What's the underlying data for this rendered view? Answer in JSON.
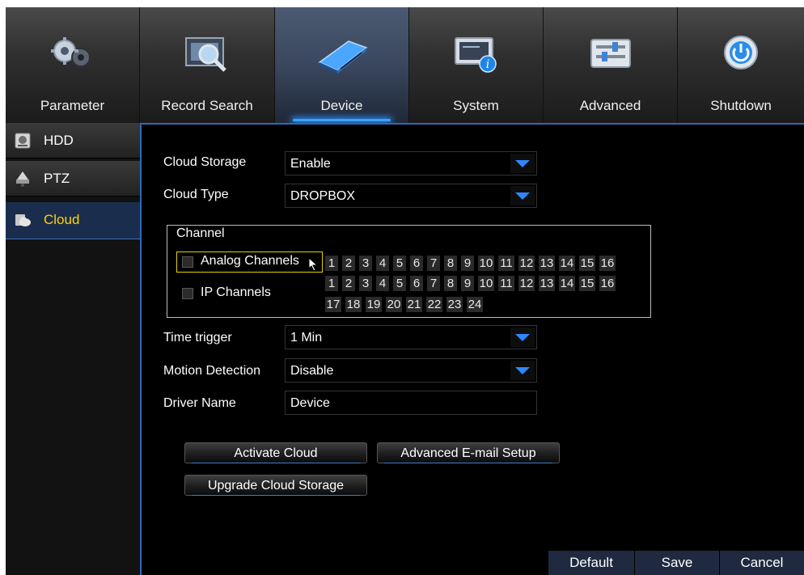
{
  "tabs": [
    {
      "label": "Parameter",
      "icon": "gears-icon"
    },
    {
      "label": "Record Search",
      "icon": "magnifier-film-icon"
    },
    {
      "label": "Device",
      "icon": "hard-drive-icon",
      "active": true
    },
    {
      "label": "System",
      "icon": "monitor-info-icon"
    },
    {
      "label": "Advanced",
      "icon": "sliders-panel-icon"
    },
    {
      "label": "Shutdown",
      "icon": "power-icon"
    }
  ],
  "sidebar": {
    "items": [
      {
        "label": "HDD",
        "icon": "hdd-icon"
      },
      {
        "label": "PTZ",
        "icon": "ptz-camera-icon"
      },
      {
        "label": "Cloud",
        "icon": "cloud-icon",
        "active": true
      }
    ]
  },
  "form": {
    "cloud_storage_label": "Cloud Storage",
    "cloud_storage_value": "Enable",
    "cloud_type_label": "Cloud Type",
    "cloud_type_value": "DROPBOX",
    "channel_title": "Channel",
    "analog_channels_label": "Analog Channels",
    "ip_channels_label": "IP Channels",
    "analog_numbers": [
      "1",
      "2",
      "3",
      "4",
      "5",
      "6",
      "7",
      "8",
      "9",
      "10",
      "11",
      "12",
      "13",
      "14",
      "15",
      "16"
    ],
    "ip_numbers_row1": [
      "1",
      "2",
      "3",
      "4",
      "5",
      "6",
      "7",
      "8",
      "9",
      "10",
      "11",
      "12",
      "13",
      "14",
      "15",
      "16"
    ],
    "ip_numbers_row2": [
      "17",
      "18",
      "19",
      "20",
      "21",
      "22",
      "23",
      "24"
    ],
    "time_trigger_label": "Time trigger",
    "time_trigger_value": "1 Min",
    "motion_detection_label": "Motion Detection",
    "motion_detection_value": "Disable",
    "driver_name_label": "Driver Name",
    "driver_name_value": "Device"
  },
  "buttons": {
    "activate_cloud": "Activate Cloud",
    "advanced_email": "Advanced E-mail Setup",
    "upgrade_cloud": "Upgrade Cloud Storage"
  },
  "footer": {
    "default": "Default",
    "save": "Save",
    "cancel": "Cancel"
  },
  "colors": {
    "accent": "#2f87ff",
    "active_sidebar_text": "#ffd200"
  }
}
